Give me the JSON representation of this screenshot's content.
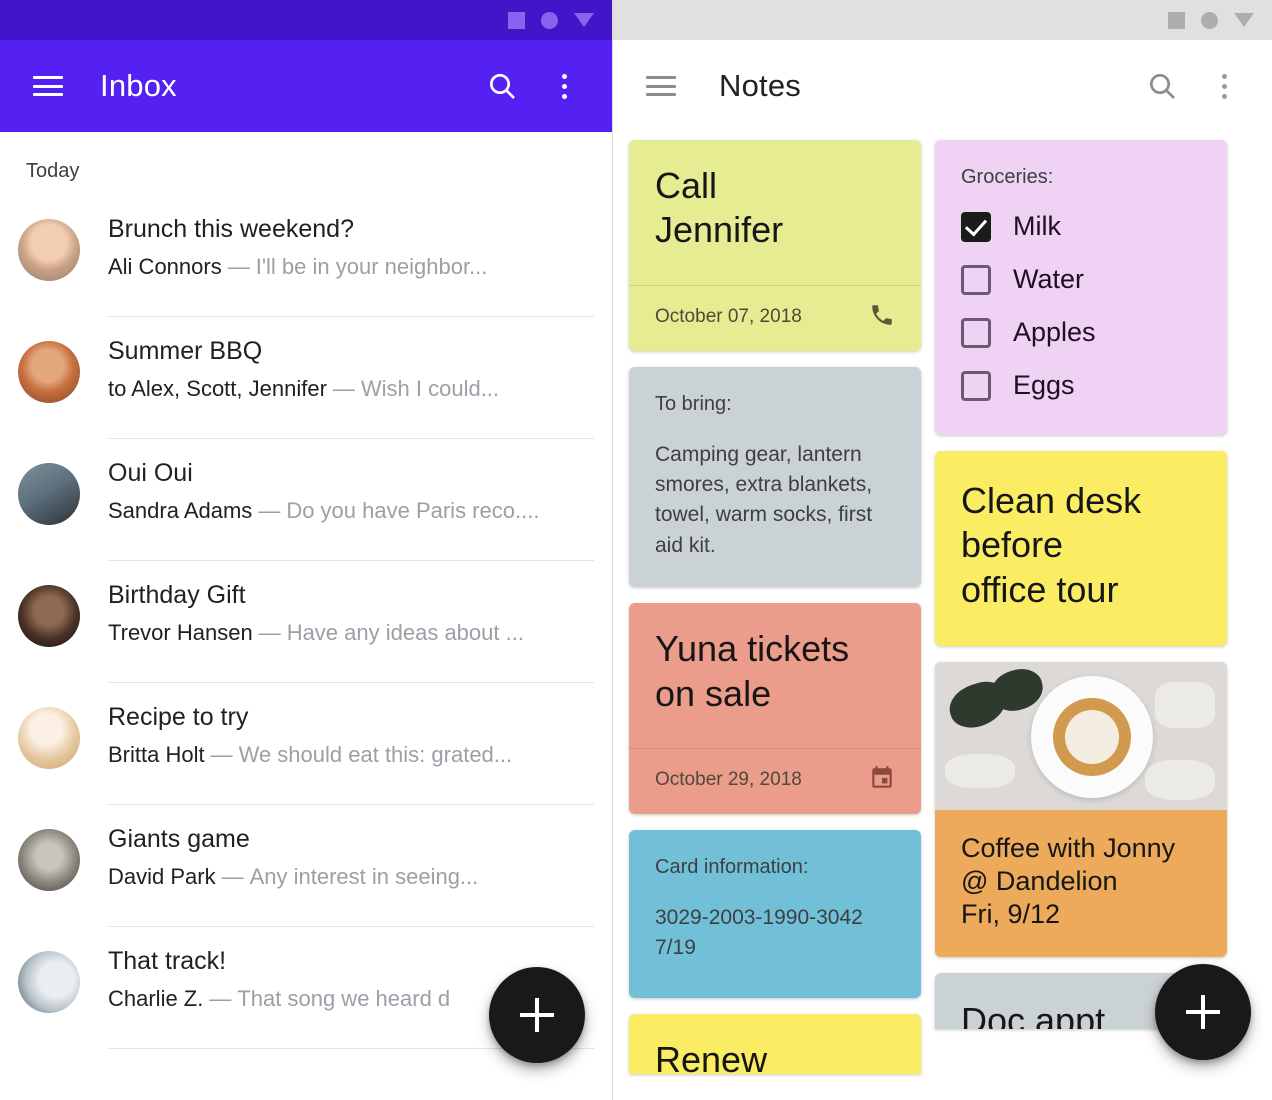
{
  "inbox": {
    "statusbar": {
      "icons": [
        "square-icon",
        "circle-icon",
        "triangle-down-icon"
      ]
    },
    "appbar": {
      "menu_icon": "hamburger-menu-icon",
      "title": "Inbox",
      "search_icon": "search-icon",
      "overflow_icon": "more-vert-icon"
    },
    "section_label": "Today",
    "messages": [
      {
        "subject": "Brunch this weekend?",
        "sender": "Ali Connors",
        "dash": "—",
        "snippet": "I'll be in your neighbor...",
        "avatar_color": "#cfa08e"
      },
      {
        "subject": "Summer BBQ",
        "sender": "to Alex, Scott, Jennifer",
        "dash": "—",
        "snippet": "Wish I could...",
        "avatar_color": "#c4764a"
      },
      {
        "subject": "Oui Oui",
        "sender": "Sandra Adams",
        "dash": "—",
        "snippet": "Do you have Paris reco....",
        "avatar_color": "#5d6f7b"
      },
      {
        "subject": "Birthday Gift",
        "sender": "Trevor Hansen",
        "dash": "—",
        "snippet": "Have any ideas about ...",
        "avatar_color": "#2a2226"
      },
      {
        "subject": "Recipe to try",
        "sender": "Britta Holt",
        "dash": "—",
        "snippet": "We should eat this: grated...",
        "avatar_color": "#e6cdae"
      },
      {
        "subject": "Giants game",
        "sender": "David Park",
        "dash": "—",
        "snippet": "Any interest in seeing...",
        "avatar_color": "#8d8d8d"
      },
      {
        "subject": "That track!",
        "sender": "Charlie Z.",
        "dash": "—",
        "snippet": "That song we heard d",
        "avatar_color": "#d7dde0"
      }
    ],
    "fab": {
      "icon": "plus-icon",
      "label": "Compose"
    }
  },
  "notes": {
    "statusbar": {
      "icons": [
        "square-icon",
        "circle-icon",
        "triangle-down-icon"
      ]
    },
    "appbar": {
      "menu_icon": "hamburger-menu-icon",
      "title": "Notes",
      "search_icon": "search-icon",
      "overflow_icon": "more-vert-icon"
    },
    "cards": {
      "call_jennifer": {
        "title": "Call\nJennifer",
        "title_line1": "Call",
        "title_line2": "Jennifer",
        "date": "October 07, 2018",
        "icon": "phone-icon",
        "color": "#e6ec91"
      },
      "to_bring": {
        "label": "To bring:",
        "text": "Camping gear, lantern smores, extra blankets, towel, warm socks, first aid kit.",
        "color": "#cbd2d6"
      },
      "yuna": {
        "title_line1": "Yuna tickets",
        "title_line2": "on sale",
        "date": "October 29, 2018",
        "icon": "calendar-icon",
        "color": "#ec9c8b"
      },
      "card_info": {
        "label": "Card information:",
        "line1": "3029-2003-1990-3042",
        "line2": "7/19",
        "color": "#72c0d8"
      },
      "renew": {
        "title": "Renew",
        "color": "#fbed63"
      },
      "groceries": {
        "label": "Groceries:",
        "color": "#f0d2f4",
        "items": [
          {
            "label": "Milk",
            "checked": true
          },
          {
            "label": "Water",
            "checked": false
          },
          {
            "label": "Apples",
            "checked": false
          },
          {
            "label": "Eggs",
            "checked": false
          }
        ]
      },
      "clean_desk": {
        "line1": "Clean desk",
        "line2": "before",
        "line3": "office tour",
        "color": "#fbed63"
      },
      "coffee": {
        "photo": "coffee-cup-photo",
        "line1": "Coffee with Jonny",
        "line2": "@ Dandelion",
        "line3": "Fri, 9/12",
        "color": "#edaa5b"
      },
      "doc_appt": {
        "title": "Doc appt",
        "color": "#cbd2d6"
      }
    },
    "fab": {
      "icon": "plus-icon",
      "label": "New note"
    }
  }
}
